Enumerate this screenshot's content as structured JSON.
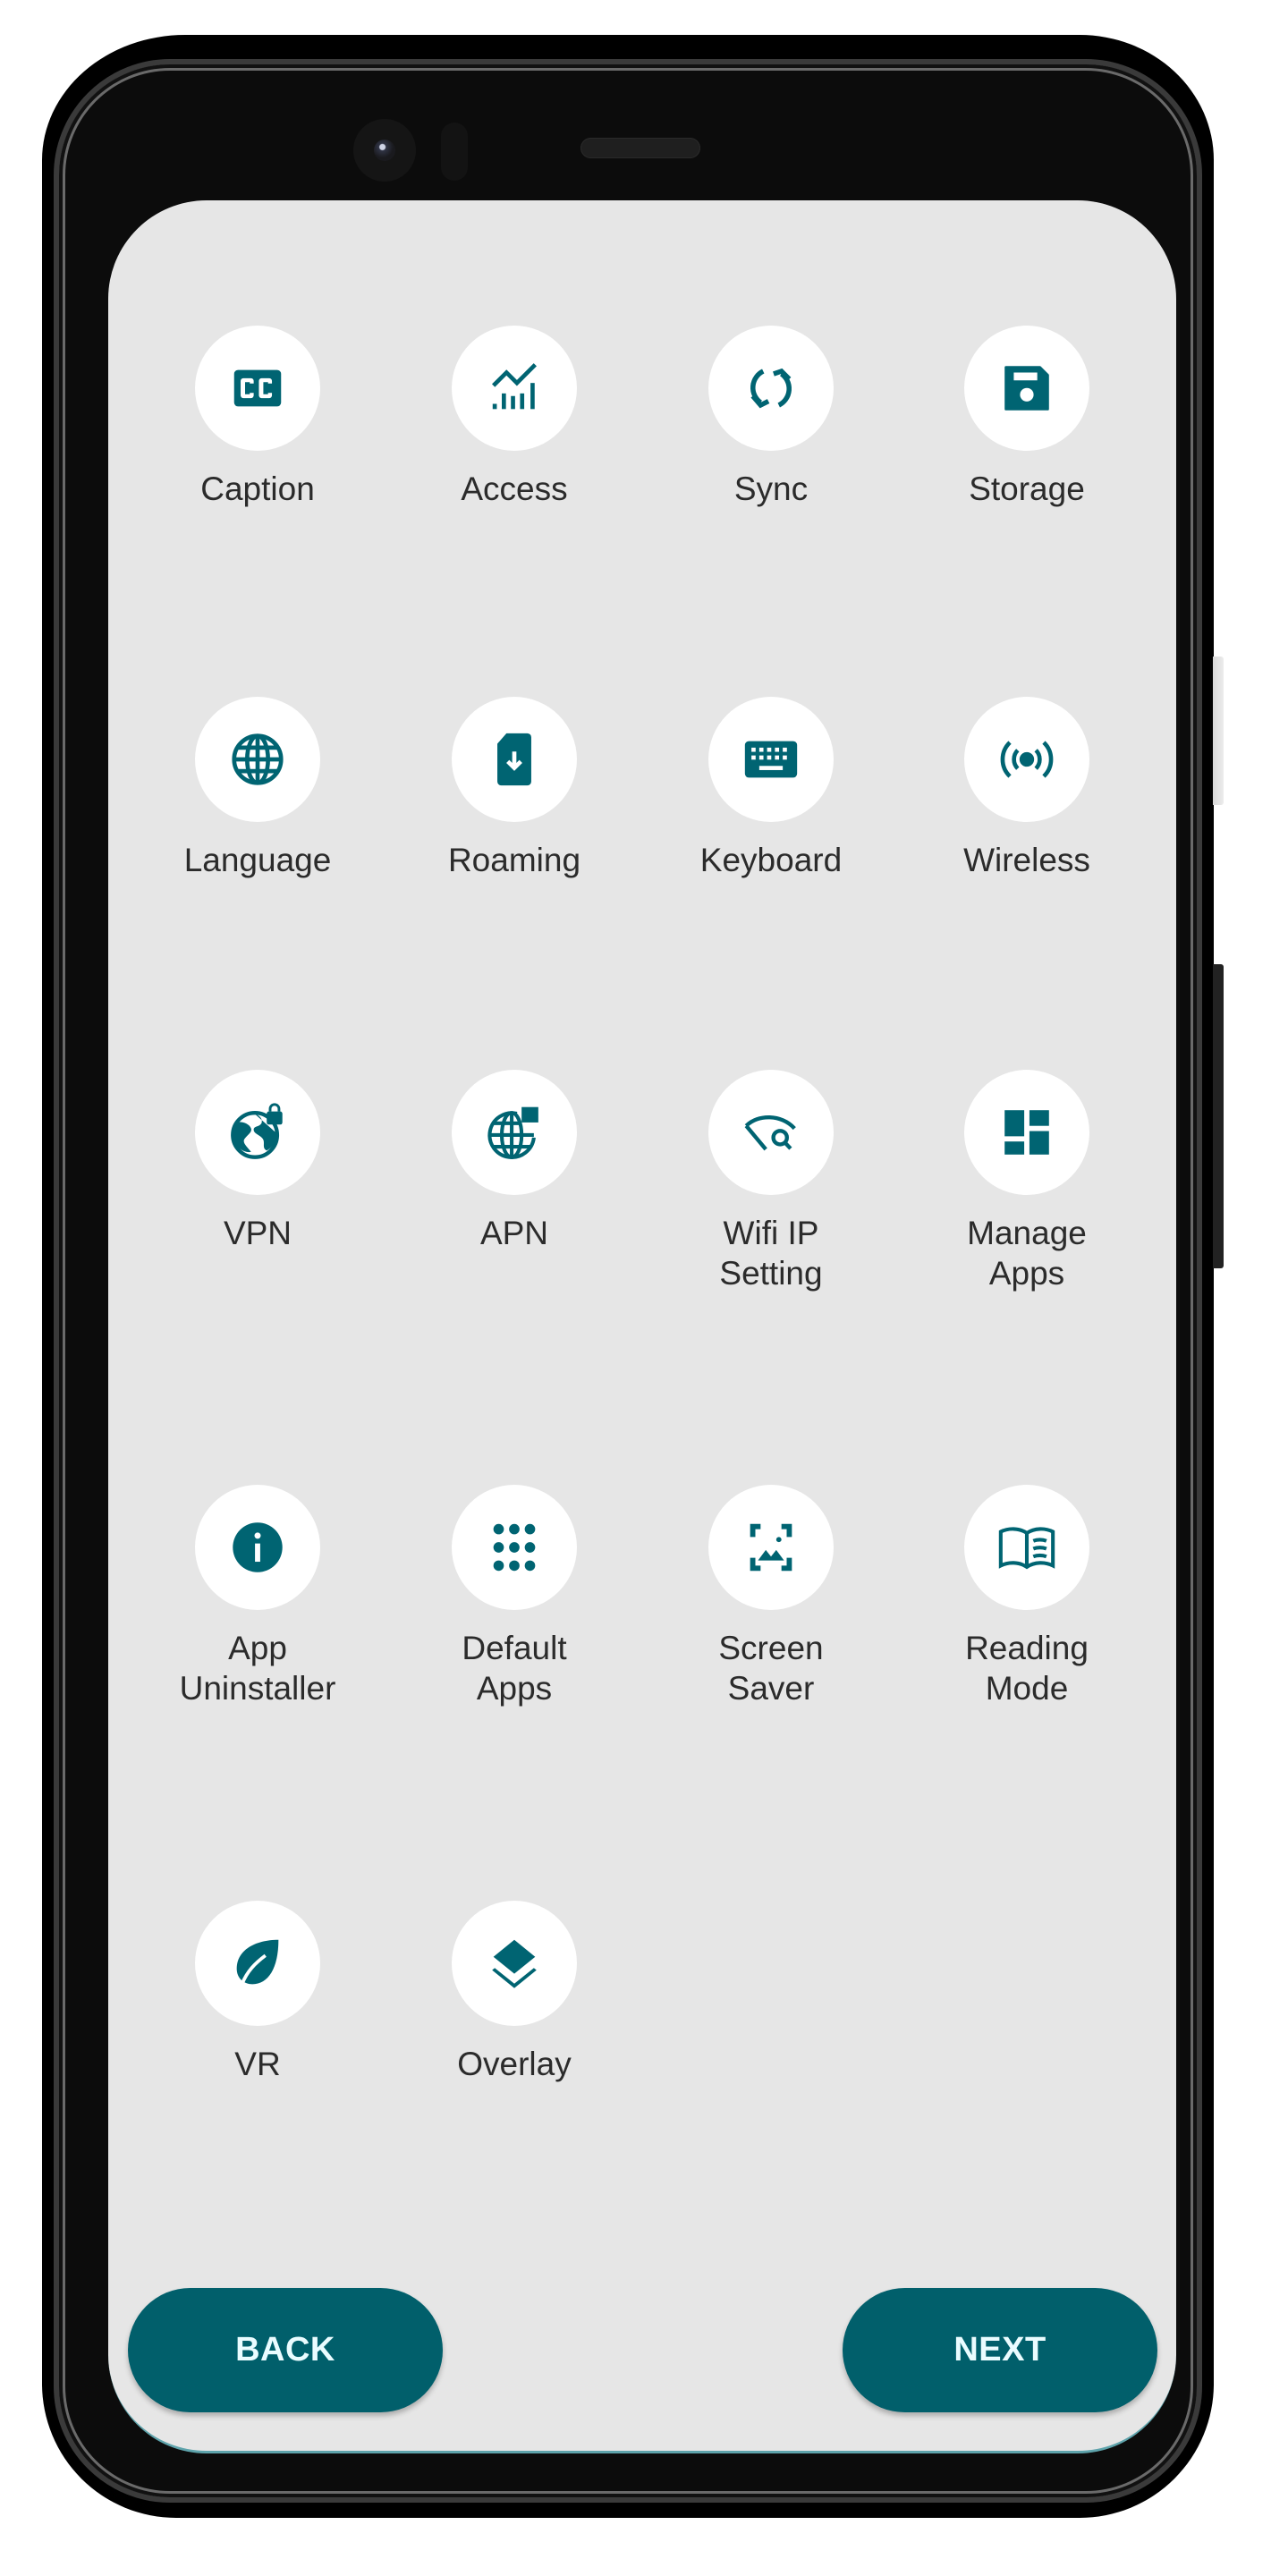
{
  "theme": {
    "accent": "#015f6b",
    "icon_color": "#006472",
    "screen_bg": "#e6e6e6",
    "label_color": "#2b2b2b"
  },
  "grid": {
    "items": [
      {
        "label": "Caption",
        "icon": "closed-caption-icon"
      },
      {
        "label": "Access",
        "icon": "trend-bars-icon"
      },
      {
        "label": "Sync",
        "icon": "sync-icon"
      },
      {
        "label": "Storage",
        "icon": "floppy-disk-icon"
      },
      {
        "label": "Language",
        "icon": "globe-icon"
      },
      {
        "label": "Roaming",
        "icon": "sim-card-download-icon"
      },
      {
        "label": "Keyboard",
        "icon": "keyboard-icon"
      },
      {
        "label": "Wireless",
        "icon": "wireless-broadcast-icon"
      },
      {
        "label": "VPN",
        "icon": "globe-lock-icon"
      },
      {
        "label": "APN",
        "icon": "globe-network-icon"
      },
      {
        "label": "Wifi IP Setting",
        "line1": "Wifi IP",
        "line2": "Setting",
        "icon": "wifi-search-icon"
      },
      {
        "label": "Manage Apps",
        "line1": "Manage",
        "line2": "Apps",
        "icon": "dashboard-tiles-icon"
      },
      {
        "label": "App Uninstaller",
        "line1": "App",
        "line2": "Uninstaller",
        "icon": "info-icon"
      },
      {
        "label": "Default Apps",
        "line1": "Default",
        "line2": "Apps",
        "icon": "apps-grid-icon"
      },
      {
        "label": "Screen Saver",
        "line1": "Screen",
        "line2": "Saver",
        "icon": "screen-image-icon"
      },
      {
        "label": "Reading Mode",
        "line1": "Reading",
        "line2": "Mode",
        "icon": "open-book-icon"
      },
      {
        "label": "VR",
        "icon": "leaf-icon"
      },
      {
        "label": "Overlay",
        "icon": "layers-icon"
      }
    ]
  },
  "footer": {
    "back_label": "BACK",
    "next_label": "NEXT"
  }
}
